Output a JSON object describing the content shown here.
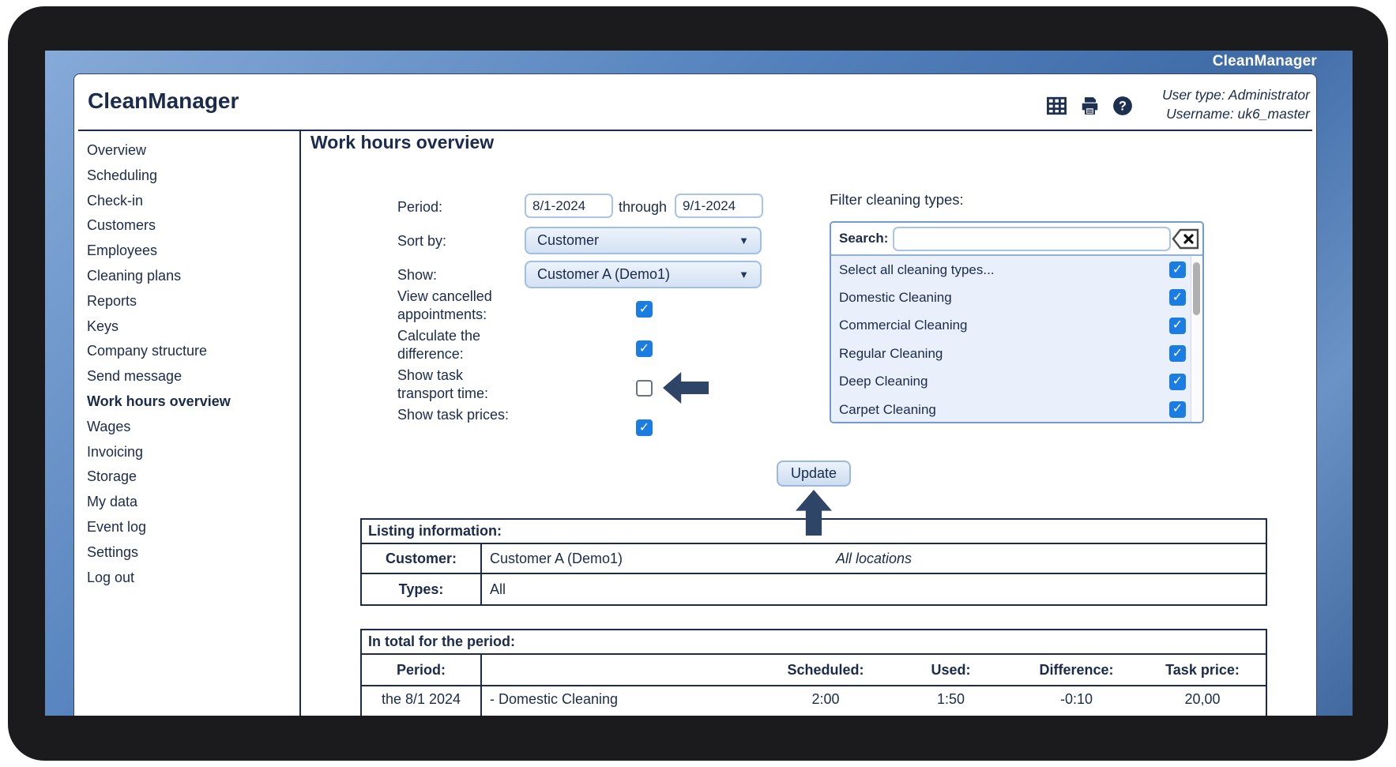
{
  "window": {
    "brand": "CleanManager"
  },
  "header": {
    "title": "CleanManager",
    "icons": [
      "table",
      "print",
      "help"
    ],
    "user_type": "User type: Administrator",
    "username": "Username: uk6_master"
  },
  "sidebar": {
    "items": [
      {
        "label": "Overview",
        "active": false
      },
      {
        "label": "Scheduling",
        "active": false
      },
      {
        "label": "Check-in",
        "active": false
      },
      {
        "label": "Customers",
        "active": false
      },
      {
        "label": "Employees",
        "active": false
      },
      {
        "label": "Cleaning plans",
        "active": false
      },
      {
        "label": "Reports",
        "active": false
      },
      {
        "label": "Keys",
        "active": false
      },
      {
        "label": "Company structure",
        "active": false
      },
      {
        "label": "Send message",
        "active": false
      },
      {
        "label": "Work hours overview",
        "active": true
      },
      {
        "label": "Wages",
        "active": false
      },
      {
        "label": "Invoicing",
        "active": false
      },
      {
        "label": "Storage",
        "active": false
      },
      {
        "label": "My data",
        "active": false
      },
      {
        "label": "Event log",
        "active": false
      },
      {
        "label": "Settings",
        "active": false
      },
      {
        "label": "Log out",
        "active": false
      }
    ]
  },
  "main": {
    "heading": "Work hours overview",
    "form": {
      "period_label": "Period:",
      "period_from": "8/1-2024",
      "through_label": "through",
      "period_to": "9/1-2024",
      "sort_label": "Sort by:",
      "sort_value": "Customer",
      "show_label": "Show:",
      "show_value": "Customer A (Demo1)",
      "checkboxes": [
        {
          "label": "View cancelled appointments:",
          "checked": true
        },
        {
          "label": "Calculate the difference:",
          "checked": true
        },
        {
          "label": "Show task transport time:",
          "checked": false
        },
        {
          "label": "Show task prices:",
          "checked": true
        }
      ]
    },
    "filter": {
      "title": "Filter cleaning types:",
      "search_label": "Search:",
      "search_value": "",
      "clear_icon": "backspace",
      "items": [
        {
          "label": "Select all cleaning types...",
          "checked": true
        },
        {
          "label": "Domestic Cleaning",
          "checked": true
        },
        {
          "label": "Commercial Cleaning",
          "checked": true
        },
        {
          "label": "Regular Cleaning",
          "checked": true
        },
        {
          "label": "Deep Cleaning",
          "checked": true
        },
        {
          "label": "Carpet Cleaning",
          "checked": true
        }
      ]
    },
    "update_button": "Update",
    "listing": {
      "title": "Listing information:",
      "customer_label": "Customer:",
      "customer_value": "Customer A (Demo1)",
      "customer_note": "All locations",
      "types_label": "Types:",
      "types_value": "All"
    },
    "totals": {
      "title": "In total for the period:",
      "columns": [
        "Period:",
        "",
        "Scheduled:",
        "Used:",
        "Difference:",
        "Task price:"
      ],
      "rows": [
        [
          "the 8/1 2024",
          "- Domestic Cleaning",
          "2:00",
          "1:50",
          "-0:10",
          "20,00"
        ]
      ]
    }
  },
  "colors": {
    "navy_text": "#1b2b4d",
    "checkbox_blue": "#1b7ce2",
    "frame_black": "#1b1b1d",
    "band_blue_light": "#86aad8",
    "band_blue_dark": "#3f6ba7",
    "panel_border": "#6f9bd0",
    "control_border": "#a9c4e6",
    "list_bg": "#e9effb",
    "arrow_navy": "#2e4568"
  }
}
